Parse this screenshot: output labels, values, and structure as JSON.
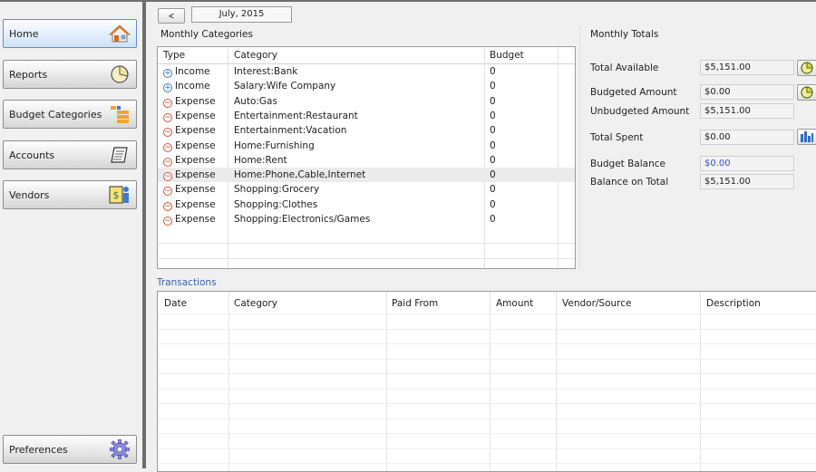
{
  "sidebar": {
    "items": [
      {
        "label": "Home",
        "icon": "house-icon"
      },
      {
        "label": "Reports",
        "icon": "pie-chart-icon"
      },
      {
        "label": "Budget Categories",
        "icon": "category-blocks-icon"
      },
      {
        "label": "Accounts",
        "icon": "ledger-book-icon"
      },
      {
        "label": "Vendors",
        "icon": "vendor-money-icon"
      }
    ],
    "preferences": {
      "label": "Preferences",
      "icon": "gear-icon"
    }
  },
  "month_nav": {
    "prev_label": "<",
    "month": "July, 2015"
  },
  "categories": {
    "title": "Monthly Categories",
    "columns": {
      "type": "Type",
      "category": "Category",
      "budget": "Budget"
    },
    "rows": [
      {
        "sign": "+",
        "type": "Income",
        "category": "Interest:Bank",
        "budget": "0"
      },
      {
        "sign": "+",
        "type": "Income",
        "category": "Salary:Wife Company",
        "budget": "0"
      },
      {
        "sign": "-",
        "type": "Expense",
        "category": "Auto:Gas",
        "budget": "0"
      },
      {
        "sign": "-",
        "type": "Expense",
        "category": "Entertainment:Restaurant",
        "budget": "0"
      },
      {
        "sign": "-",
        "type": "Expense",
        "category": "Entertainment:Vacation",
        "budget": "0"
      },
      {
        "sign": "-",
        "type": "Expense",
        "category": "Home:Furnishing",
        "budget": "0"
      },
      {
        "sign": "-",
        "type": "Expense",
        "category": "Home:Rent",
        "budget": "0"
      },
      {
        "sign": "-",
        "type": "Expense",
        "category": "Home:Phone,Cable,Internet",
        "budget": "0",
        "selected": true
      },
      {
        "sign": "-",
        "type": "Expense",
        "category": "Shopping:Grocery",
        "budget": "0"
      },
      {
        "sign": "-",
        "type": "Expense",
        "category": "Shopping:Clothes",
        "budget": "0"
      },
      {
        "sign": "-",
        "type": "Expense",
        "category": "Shopping:Electronics/Games",
        "budget": "0"
      }
    ]
  },
  "totals": {
    "title": "Monthly Totals",
    "total_available": {
      "label": "Total Available",
      "value": "$5,151.00"
    },
    "budgeted_amount": {
      "label": "Budgeted Amount",
      "value": "$0.00"
    },
    "unbudgeted_amount": {
      "label": "Unbudgeted Amount",
      "value": "$5,151.00"
    },
    "total_spent": {
      "label": "Total Spent",
      "value": "$0.00"
    },
    "budget_balance": {
      "label": "Budget Balance",
      "value": "$0.00"
    },
    "balance_on_total": {
      "label": "Balance on Total",
      "value": "$5,151.00"
    }
  },
  "transactions": {
    "title": "Transactions",
    "columns": {
      "date": "Date",
      "category": "Category",
      "paid_from": "Paid From",
      "amount": "Amount",
      "vendor": "Vendor/Source",
      "description": "Description"
    }
  },
  "colors": {
    "accent": "#3a64b0",
    "income": "#2d6fc7",
    "expense": "#c9471f",
    "balance_value": "#3050c8"
  }
}
